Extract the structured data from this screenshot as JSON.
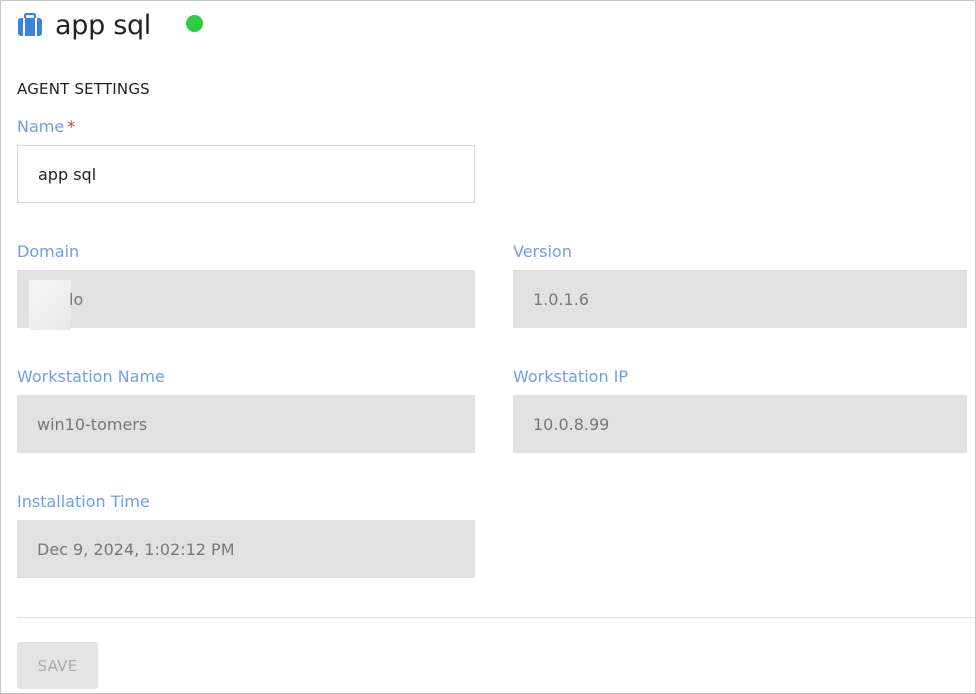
{
  "header": {
    "title": "app sql",
    "icon": "briefcase-icon",
    "status_color": "#2ecc40"
  },
  "section_title": "AGENT SETTINGS",
  "fields": {
    "name": {
      "label": "Name",
      "required_mark": "*",
      "value": "app sql"
    },
    "domain": {
      "label": "Domain",
      "value": "lo"
    },
    "version": {
      "label": "Version",
      "value": "1.0.1.6"
    },
    "workstation_name": {
      "label": "Workstation Name",
      "value": "win10-tomers"
    },
    "workstation_ip": {
      "label": "Workstation IP",
      "value": "10.0.8.99"
    },
    "installation_time": {
      "label": "Installation Time",
      "value": "Dec 9, 2024, 1:02:12 PM"
    }
  },
  "save_button": {
    "label": "SAVE"
  },
  "colors": {
    "label": "#6d9fe6",
    "icon": "#3b82e6",
    "readonly_bg": "#e1e1e1"
  }
}
